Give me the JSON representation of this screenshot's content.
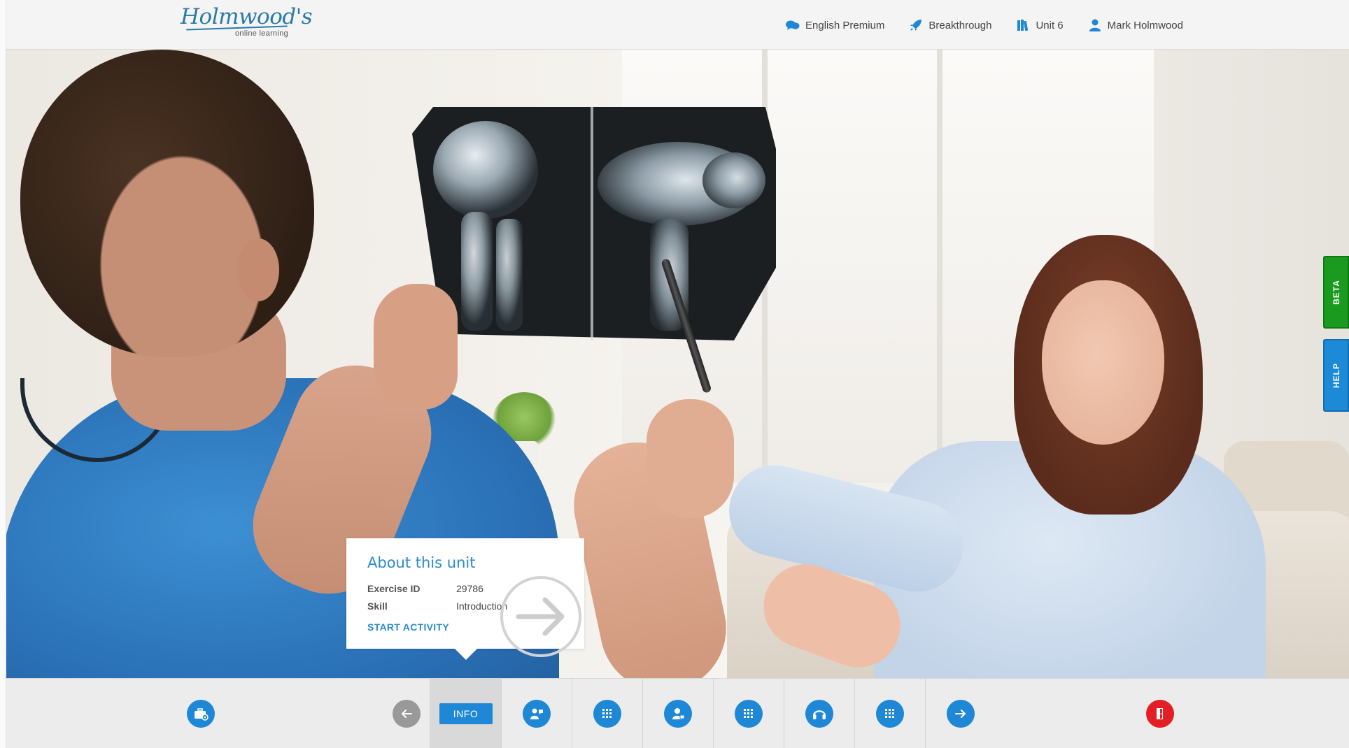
{
  "brand": {
    "logo_text": "Holmwood's",
    "logo_tagline": "online learning"
  },
  "topnav": {
    "items": [
      {
        "label": "English Premium",
        "icon": "speech-bubbles-icon"
      },
      {
        "label": "Breakthrough",
        "icon": "rocket-icon"
      },
      {
        "label": "Unit 6",
        "icon": "books-icon"
      },
      {
        "label": "Mark Holmwood",
        "icon": "user-icon"
      }
    ]
  },
  "info_card": {
    "title": "About this unit",
    "rows": [
      {
        "label": "Exercise ID",
        "value": "29786"
      },
      {
        "label": "Skill",
        "value": "Introduction"
      }
    ],
    "action": "START ACTIVITY"
  },
  "side_tabs": {
    "beta": "BETA",
    "help": "HELP"
  },
  "bottom_bar": {
    "info_label": "INFO",
    "buttons": [
      {
        "name": "dashboard",
        "icon": "toolbox-icon"
      },
      {
        "name": "previous",
        "icon": "arrow-left-icon"
      },
      {
        "name": "info",
        "icon": "info-icon"
      },
      {
        "name": "speaking-activity",
        "icon": "person-speaking-icon"
      },
      {
        "name": "grid-activity-1",
        "icon": "grid-icon"
      },
      {
        "name": "user-activity",
        "icon": "person-card-icon"
      },
      {
        "name": "grid-activity-2",
        "icon": "grid-icon"
      },
      {
        "name": "listening-activity",
        "icon": "headphones-icon"
      },
      {
        "name": "grid-activity-3",
        "icon": "grid-icon"
      },
      {
        "name": "next",
        "icon": "arrow-right-icon"
      },
      {
        "name": "exit",
        "icon": "exit-door-icon"
      }
    ]
  },
  "colors": {
    "accent": "#1e88d6",
    "beta": "#1a9a1f",
    "exit": "#e31e24",
    "disabled": "#999999"
  }
}
